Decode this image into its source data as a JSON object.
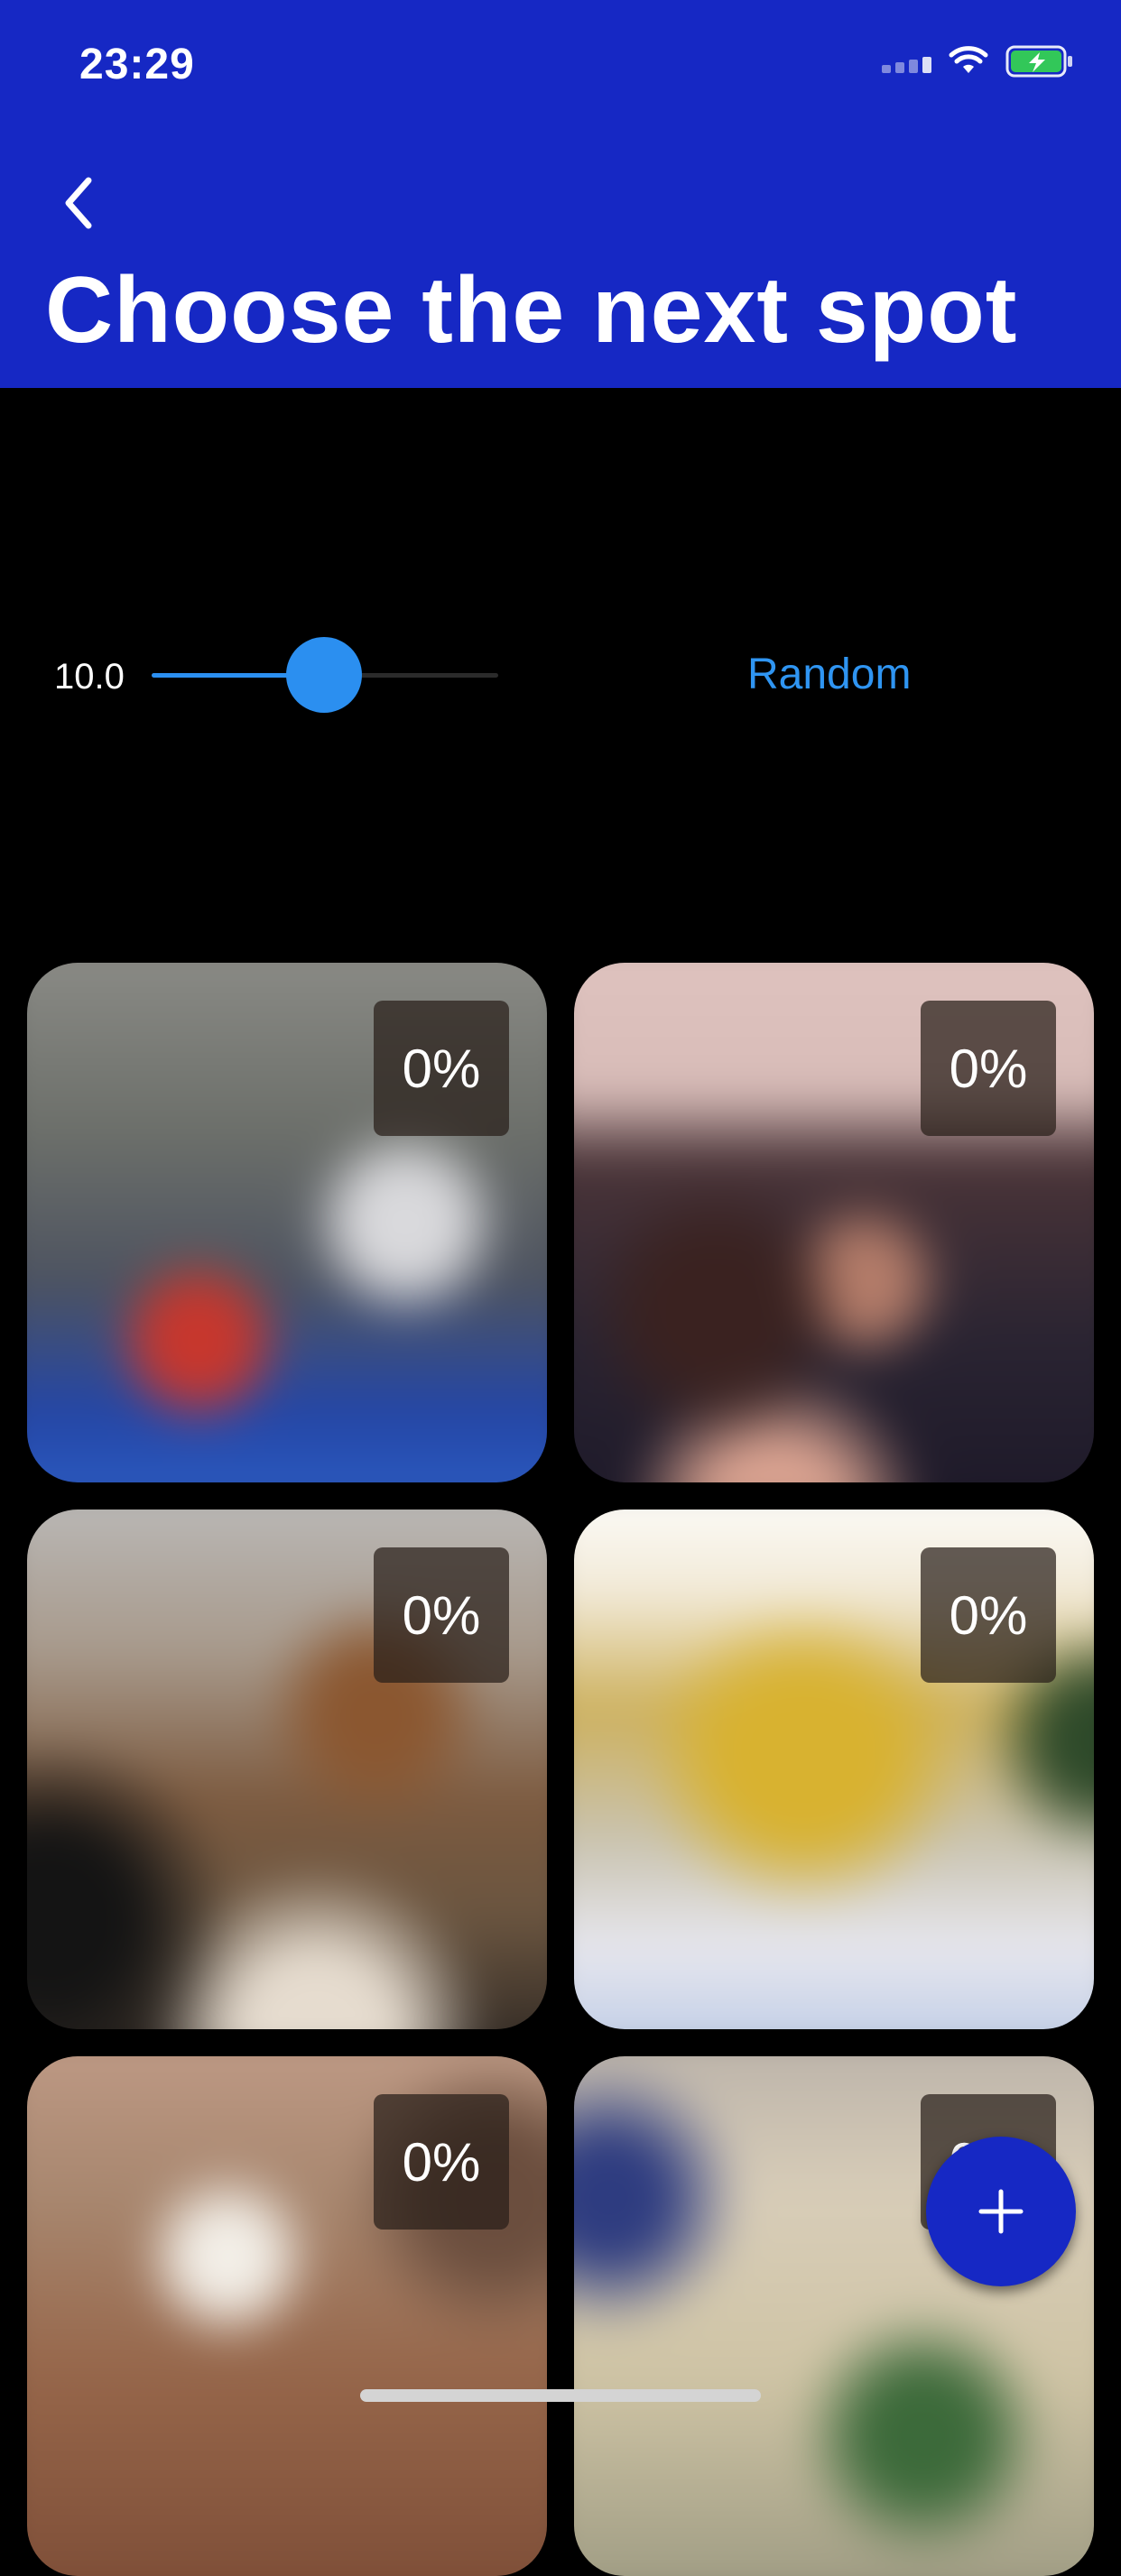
{
  "status_bar": {
    "time": "23:29",
    "icons": [
      "cellular-signal-icon",
      "wifi-icon",
      "battery-charging-icon"
    ]
  },
  "header": {
    "back_icon": "chevron-left-icon",
    "title": "Choose the next spot"
  },
  "controls": {
    "slider_value_label": "10.0",
    "slider_fraction": 0.5,
    "random_label": "Random"
  },
  "tiles": [
    {
      "badge": "0%"
    },
    {
      "badge": "0%"
    },
    {
      "badge": "0%"
    },
    {
      "badge": "0%"
    },
    {
      "badge": "0%"
    },
    {
      "badge": "0%"
    }
  ],
  "fab": {
    "icon": "plus-icon"
  },
  "colors": {
    "header_bg": "#1628c4",
    "accent": "#2b8ff0",
    "background": "#000000"
  }
}
